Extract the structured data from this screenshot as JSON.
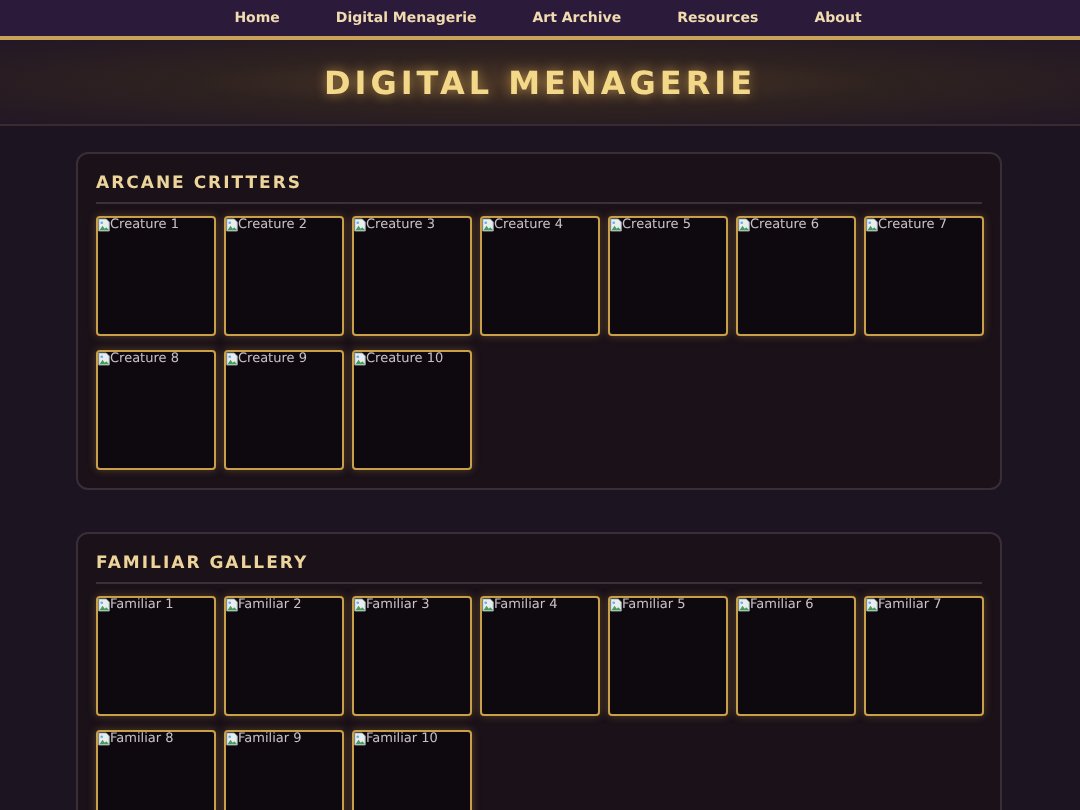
{
  "nav": {
    "items": [
      "Home",
      "Digital Menagerie",
      "Art Archive",
      "Resources",
      "About"
    ]
  },
  "header": {
    "title": "DIGITAL MENAGERIE"
  },
  "sections": [
    {
      "title": "ARCANE CRITTERS",
      "tiles": [
        "Creature 1",
        "Creature 2",
        "Creature 3",
        "Creature 4",
        "Creature 5",
        "Creature 6",
        "Creature 7",
        "Creature 8",
        "Creature 9",
        "Creature 10"
      ]
    },
    {
      "title": "FAMILIAR GALLERY",
      "tiles": [
        "Familiar 1",
        "Familiar 2",
        "Familiar 3",
        "Familiar 4",
        "Familiar 5",
        "Familiar 6",
        "Familiar 7",
        "Familiar 8",
        "Familiar 9",
        "Familiar 10"
      ]
    }
  ]
}
